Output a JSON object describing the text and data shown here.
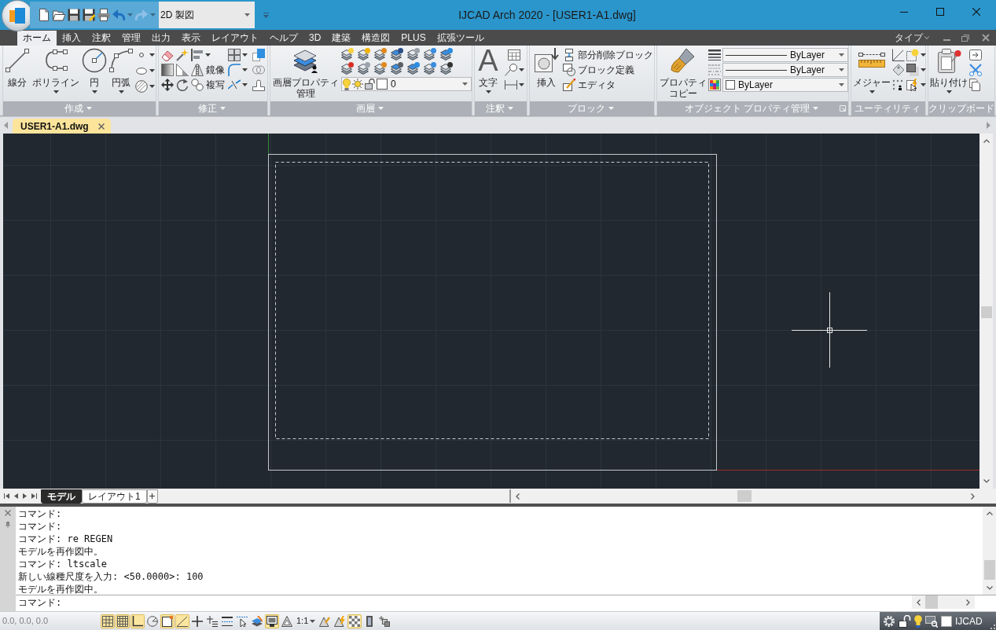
{
  "title_bar": {
    "workspace": "2D 製図",
    "title": "IJCAD Arch 2020 - [USER1-A1.dwg]"
  },
  "ribbon": {
    "tabs": [
      {
        "label": "ホーム",
        "selected": true
      },
      {
        "label": "挿入",
        "selected": false
      },
      {
        "label": "注釈",
        "selected": false
      },
      {
        "label": "管理",
        "selected": false
      },
      {
        "label": "出力",
        "selected": false
      },
      {
        "label": "表示",
        "selected": false
      },
      {
        "label": "レイアウト",
        "selected": false
      },
      {
        "label": "ヘルプ",
        "selected": false
      },
      {
        "label": "3D",
        "selected": false
      },
      {
        "label": "建築",
        "selected": false
      },
      {
        "label": "構造図",
        "selected": false
      },
      {
        "label": "PLUS",
        "selected": false
      },
      {
        "label": "拡張ツール",
        "selected": false
      }
    ],
    "help_label": "タイプ",
    "panels": [
      {
        "title": "作成",
        "expandable": true,
        "launcher": false,
        "large_buttons": [
          {
            "label": "線分",
            "menu": false
          },
          {
            "label": "ポリライン",
            "menu": true
          },
          {
            "label": "円",
            "menu": true
          },
          {
            "label": "円弧",
            "menu": true
          }
        ]
      },
      {
        "title": "修正",
        "expandable": true,
        "launcher": false,
        "small_buttons": [
          {
            "label": "鏡像"
          },
          {
            "label": "複写"
          }
        ]
      },
      {
        "title": "画層",
        "expandable": true,
        "launcher": false,
        "large_buttons": [
          {
            "label": "画層プロパティ管理",
            "menu": false
          }
        ],
        "layer_dropdown": {
          "value": "0"
        }
      },
      {
        "title": "注釈",
        "expandable": true,
        "launcher": false,
        "large_buttons": [
          {
            "label": "文字",
            "glyph": "A",
            "menu": true
          }
        ]
      },
      {
        "title": "ブロック",
        "expandable": true,
        "launcher": false,
        "large_buttons": [
          {
            "label": "挿入",
            "menu": false
          }
        ],
        "small_buttons": [
          {
            "label": "部分削除ブロック"
          },
          {
            "label": "ブロック定義"
          },
          {
            "label": "エディタ"
          }
        ]
      },
      {
        "title": "オブジェクト プロパティ管理",
        "expandable": true,
        "launcher": true,
        "large_buttons": [
          {
            "label": "プロパティコピー",
            "menu": false
          }
        ],
        "dropdowns": [
          {
            "kind": "lineweight",
            "value": "ByLayer"
          },
          {
            "kind": "linetype",
            "value": "ByLayer"
          },
          {
            "kind": "color",
            "value": "ByLayer"
          }
        ]
      },
      {
        "title": "ユーティリティ",
        "expandable": false,
        "launcher": false,
        "large_buttons": [
          {
            "label": "メジャー",
            "menu": true
          }
        ]
      },
      {
        "title": "クリップボード",
        "expandable": false,
        "launcher": false,
        "large_buttons": [
          {
            "label": "貼り付け",
            "menu": true
          }
        ]
      }
    ]
  },
  "document_tabs": [
    {
      "label": "USER1-A1.dwg",
      "selected": true
    }
  ],
  "layout_tabs": [
    {
      "label": "モデル",
      "selected": true
    },
    {
      "label": "レイアウト1",
      "selected": false
    }
  ],
  "command_window": {
    "history": [
      "コマンド:",
      "コマンド:",
      "コマンド: re REGEN",
      "モデルを再作図中。",
      "コマンド: ltscale",
      "新しい線種尺度を入力: <50.0000>: 100",
      "モデルを再作図中。"
    ],
    "prompt": "コマンド:"
  },
  "status_bar": {
    "coordinates": "0.0, 0.0, 0.0",
    "toggles": [
      {
        "kind": "grid",
        "on": true
      },
      {
        "kind": "snapgrid",
        "on": true
      },
      {
        "kind": "corner",
        "on": true
      },
      {
        "kind": "polar",
        "on": false
      },
      {
        "kind": "square",
        "on": true
      },
      {
        "kind": "angle",
        "on": true
      },
      {
        "kind": "cross",
        "on": false
      },
      {
        "kind": "crosslines",
        "on": false
      },
      {
        "kind": "lines",
        "on": false
      },
      {
        "kind": "pointer",
        "on": false
      },
      {
        "kind": "layers",
        "on": false
      },
      {
        "kind": "monitor",
        "on": true
      },
      {
        "kind": "triangle",
        "on": false
      }
    ],
    "annotation_scale": "1:1",
    "annotation_toggles": [
      {
        "kind": "pencil",
        "on": false
      },
      {
        "kind": "bolt",
        "on": false
      },
      {
        "kind": "checker",
        "on": true
      },
      {
        "kind": "bar",
        "on": false
      },
      {
        "kind": "squares",
        "on": false
      }
    ],
    "tray_label": "IJCAD"
  }
}
